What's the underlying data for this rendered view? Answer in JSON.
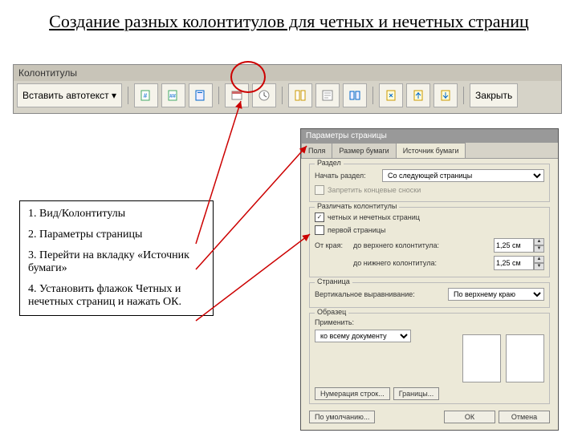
{
  "title": "Создание разных колонтитулов для четных и нечетных страниц",
  "toolbar": {
    "caption": "Колонтитулы",
    "autotext": "Вставить автотекст ▾",
    "close": "Закрыть"
  },
  "steps": {
    "s1": "1. Вид/Колонтитулы",
    "s2": "2. Параметры страницы",
    "s3": "3. Перейти на вкладку «Источник бумаги»",
    "s4": "4. Установить флажок Четных и нечетных страниц и нажать ОК."
  },
  "dialog": {
    "caption": "Параметры страницы",
    "tabs": {
      "t1": "Поля",
      "t2": "Размер бумаги",
      "t3": "Источник бумаги"
    },
    "section_group": "Раздел",
    "section_start": "Начать раздел:",
    "section_val": "Со следующей страницы",
    "suppress": "Запретить концевые сноски",
    "hf_group": "Различать колонтитулы",
    "odd_even": "четных и нечетных страниц",
    "first_page": "первой страницы",
    "from_edge": "От края:",
    "to_header": "до верхнего колонтитула:",
    "to_footer": "до нижнего колонтитула:",
    "dist": "1,25 см",
    "page_group": "Страница",
    "valign_lbl": "Вертикальное выравнивание:",
    "valign_val": "По верхнему краю",
    "preview_group": "Образец",
    "apply_lbl": "Применить:",
    "apply_val": "ко всему документу",
    "line_num": "Нумерация строк...",
    "borders": "Границы...",
    "defaults": "По умолчанию...",
    "ok": "ОК",
    "cancel": "Отмена"
  }
}
